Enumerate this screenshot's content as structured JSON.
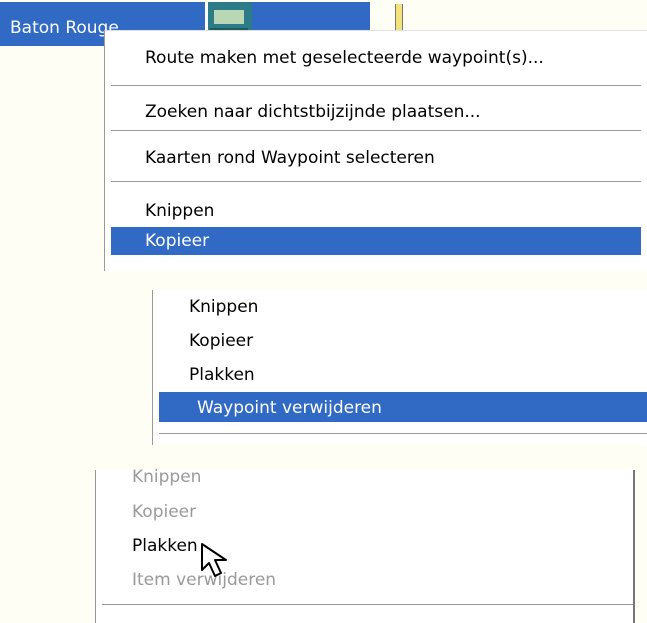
{
  "colors": {
    "selection": "#316ac5",
    "background": "#fffef5",
    "disabled_text": "#9a9a9a"
  },
  "panel1": {
    "waypoint_name": "Baton Rouge",
    "menu": [
      {
        "label": "Route maken met geselecteerde waypoint(s)..."
      },
      {
        "label": "Zoeken naar dichtstbijzijnde plaatsen..."
      },
      {
        "label": "Kaarten rond Waypoint selecteren"
      },
      {
        "label": "Knippen"
      },
      {
        "label": "Kopieer",
        "selected": true
      }
    ]
  },
  "panel2": {
    "menu": [
      {
        "label": "Knippen"
      },
      {
        "label": "Kopieer"
      },
      {
        "label": "Plakken"
      },
      {
        "label": "Waypoint verwijderen",
        "selected": true
      }
    ]
  },
  "panel3": {
    "menu": [
      {
        "label": "Knippen",
        "disabled": true
      },
      {
        "label": "Kopieer",
        "disabled": true
      },
      {
        "label": "Plakken",
        "hovered": true
      },
      {
        "label": "Item verwijderen",
        "disabled": true
      }
    ],
    "cursor_icon": "arrow-cursor-icon"
  }
}
